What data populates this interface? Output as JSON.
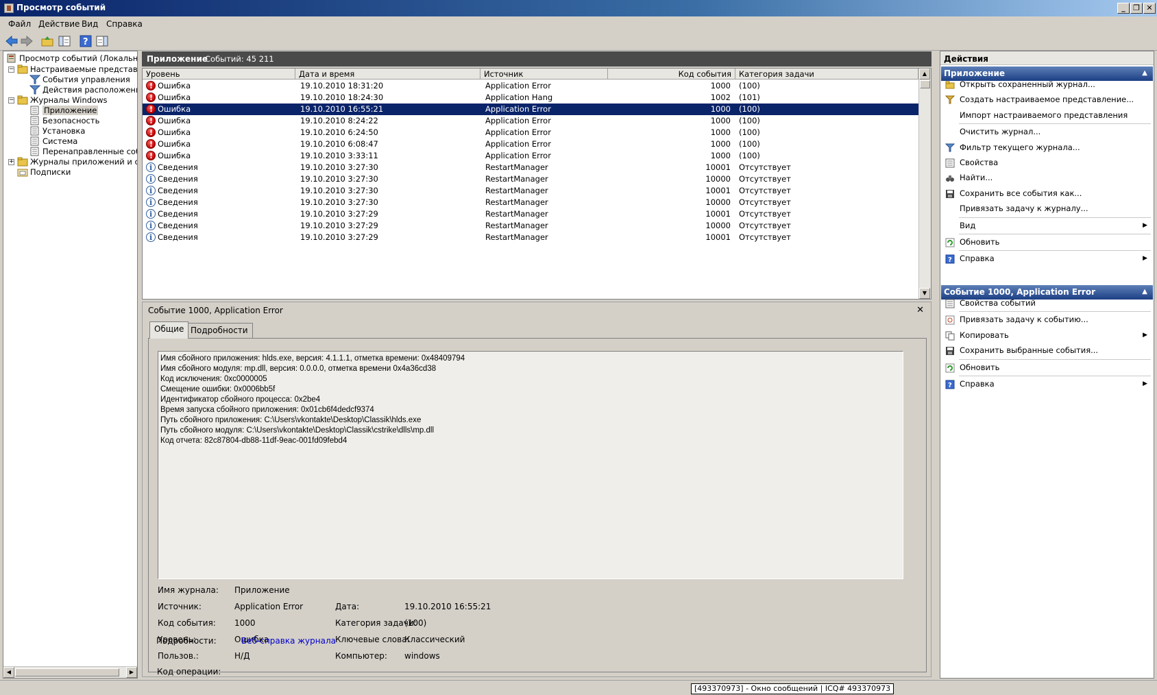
{
  "window": {
    "title": "Просмотр событий"
  },
  "menu": [
    "Файл",
    "Действие",
    "Вид",
    "Справка"
  ],
  "toolbar": [
    "back-icon",
    "forward-icon",
    "up-folder-icon",
    "show-hide-tree-icon",
    "help-icon",
    "show-hide-actions-icon"
  ],
  "tree": {
    "root": "Просмотр событий (Локальный)",
    "custom_views": "Настраиваемые представлени",
    "admin_events": "События управления",
    "location_actions": "Действия расположения",
    "windows_logs": "Журналы Windows",
    "application": "Приложение",
    "security": "Безопасность",
    "setup": "Установка",
    "system": "Система",
    "forwarded": "Перенаправленные событ",
    "app_service_logs": "Журналы приложений и служ",
    "subscriptions": "Подписки"
  },
  "log_header": {
    "name": "Приложение",
    "count": "Событий: 45 211"
  },
  "grid": {
    "columns": [
      "Уровень",
      "Дата и время",
      "Источник",
      "Код события",
      "Категория задачи"
    ],
    "rows": [
      {
        "level": "Ошибка",
        "type": "error",
        "date": "19.10.2010 18:31:20",
        "source": "Application Error",
        "id": "1000",
        "category": "(100)"
      },
      {
        "level": "Ошибка",
        "type": "error",
        "date": "19.10.2010 18:24:30",
        "source": "Application Hang",
        "id": "1002",
        "category": "(101)"
      },
      {
        "level": "Ошибка",
        "type": "error",
        "date": "19.10.2010 16:55:21",
        "source": "Application Error",
        "id": "1000",
        "category": "(100)",
        "selected": true
      },
      {
        "level": "Ошибка",
        "type": "error",
        "date": "19.10.2010 8:24:22",
        "source": "Application Error",
        "id": "1000",
        "category": "(100)"
      },
      {
        "level": "Ошибка",
        "type": "error",
        "date": "19.10.2010 6:24:50",
        "source": "Application Error",
        "id": "1000",
        "category": "(100)"
      },
      {
        "level": "Ошибка",
        "type": "error",
        "date": "19.10.2010 6:08:47",
        "source": "Application Error",
        "id": "1000",
        "category": "(100)"
      },
      {
        "level": "Ошибка",
        "type": "error",
        "date": "19.10.2010 3:33:11",
        "source": "Application Error",
        "id": "1000",
        "category": "(100)"
      },
      {
        "level": "Сведения",
        "type": "info",
        "date": "19.10.2010 3:27:30",
        "source": "RestartManager",
        "id": "10001",
        "category": "Отсутствует"
      },
      {
        "level": "Сведения",
        "type": "info",
        "date": "19.10.2010 3:27:30",
        "source": "RestartManager",
        "id": "10000",
        "category": "Отсутствует"
      },
      {
        "level": "Сведения",
        "type": "info",
        "date": "19.10.2010 3:27:30",
        "source": "RestartManager",
        "id": "10001",
        "category": "Отсутствует"
      },
      {
        "level": "Сведения",
        "type": "info",
        "date": "19.10.2010 3:27:30",
        "source": "RestartManager",
        "id": "10000",
        "category": "Отсутствует"
      },
      {
        "level": "Сведения",
        "type": "info",
        "date": "19.10.2010 3:27:29",
        "source": "RestartManager",
        "id": "10001",
        "category": "Отсутствует"
      },
      {
        "level": "Сведения",
        "type": "info",
        "date": "19.10.2010 3:27:29",
        "source": "RestartManager",
        "id": "10000",
        "category": "Отсутствует"
      },
      {
        "level": "Сведения",
        "type": "info",
        "date": "19.10.2010 3:27:29",
        "source": "RestartManager",
        "id": "10001",
        "category": "Отсутствует"
      }
    ]
  },
  "detail": {
    "title": "Событие 1000, Application Error",
    "close": "✕",
    "tabs": [
      "Общие",
      "Подробности"
    ],
    "description": [
      "Имя сбойного приложения: hlds.exe, версия: 4.1.1.1, отметка времени: 0x48409794",
      "Имя сбойного модуля: mp.dll, версия: 0.0.0.0, отметка времени 0x4a36cd38",
      "Код исключения: 0xc0000005",
      "Смещение ошибки: 0x0006bb5f",
      "Идентификатор сбойного процесса: 0x2be4",
      "Время запуска сбойного приложения: 0x01cb6f4dedcf9374",
      "Путь сбойного приложения: C:\\Users\\vkontakte\\Desktop\\Classik\\hlds.exe",
      "Путь сбойного модуля: C:\\Users\\vkontakte\\Desktop\\Classik\\cstrike\\dlls\\mp.dll",
      "Код отчета: 82c87804-db88-11df-9eac-001fd09febd4"
    ],
    "props": {
      "log_name_label": "Имя журнала:",
      "log_name": "Приложение",
      "source_label": "Источник:",
      "source": "Application Error",
      "date_label": "Дата:",
      "date": "19.10.2010 16:55:21",
      "event_id_label": "Код события:",
      "event_id": "1000",
      "category_label": "Категория задачи:",
      "category": "(100)",
      "level_label": "Уровень:",
      "level": "Ошибка",
      "keywords_label": "Ключевые слова:",
      "keywords": "Классический",
      "user_label": "Пользов.:",
      "user": "Н/Д",
      "computer_label": "Компьютер:",
      "computer": "windows",
      "opcode_label": "Код операции:",
      "more_label": "Подробности:",
      "more_link": "Веб-справка журнала"
    }
  },
  "actions": {
    "title": "Действия",
    "section1": "Приложение",
    "items1": [
      {
        "label": "Открыть сохраненный журнал...",
        "icon": "open-folder-icon"
      },
      {
        "label": "Создать настраиваемое представление...",
        "icon": "filter-new-icon"
      },
      {
        "label": "Импорт настраиваемого представления",
        "icon": ""
      },
      {
        "label": "Очистить журнал...",
        "icon": ""
      },
      {
        "label": "Фильтр текущего журнала...",
        "icon": "filter-icon"
      },
      {
        "label": "Свойства",
        "icon": "properties-icon"
      },
      {
        "label": "Найти...",
        "icon": "binoculars-icon"
      },
      {
        "label": "Сохранить все события как...",
        "icon": "save-icon"
      },
      {
        "label": "Привязать задачу к журналу...",
        "icon": ""
      },
      {
        "label": "Вид",
        "icon": "",
        "submenu": true
      },
      {
        "label": "Обновить",
        "icon": "refresh-icon"
      },
      {
        "label": "Справка",
        "icon": "help-icon",
        "submenu": true
      }
    ],
    "section2": "Событие 1000, Application Error",
    "items2": [
      {
        "label": "Свойства событий",
        "icon": "properties-icon"
      },
      {
        "label": "Привязать задачу к событию...",
        "icon": "task-icon"
      },
      {
        "label": "Копировать",
        "icon": "copy-icon",
        "submenu": true
      },
      {
        "label": "Сохранить выбранные события...",
        "icon": "save-icon"
      },
      {
        "label": "Обновить",
        "icon": "refresh-icon"
      },
      {
        "label": "Справка",
        "icon": "help-icon",
        "submenu": true
      }
    ]
  },
  "status": {
    "message": "[493370973] - Окно сообщений | ICQ# 493370973"
  },
  "colors": {
    "selection": "#0a246a",
    "section": "#1c3f84",
    "error": "#c00000",
    "link": "#0000cc"
  }
}
